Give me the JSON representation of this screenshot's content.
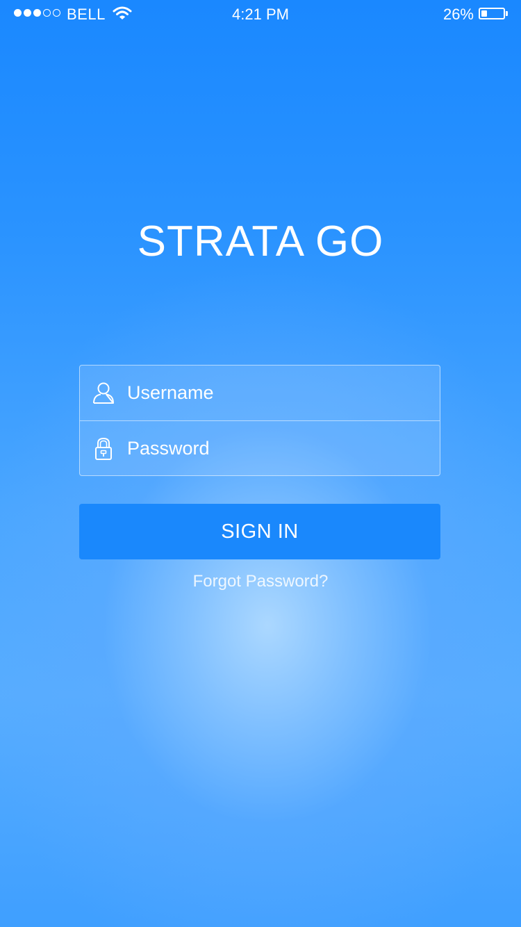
{
  "status_bar": {
    "signal_bars_filled": 3,
    "signal_bars_total": 5,
    "carrier": "BELL",
    "time": "4:21 PM",
    "battery_percent": "26%",
    "battery_level": 0.26
  },
  "app": {
    "title": "STRATA GO"
  },
  "login": {
    "username_placeholder": "Username",
    "password_placeholder": "Password",
    "sign_in_label": "SIGN IN",
    "forgot_password_label": "Forgot Password?"
  },
  "icons": {
    "username": "user-icon",
    "password": "lock-icon",
    "wifi": "wifi-icon",
    "battery": "battery-icon"
  },
  "colors": {
    "background_top": "#1a88ff",
    "background_glow": "#b0daff",
    "button": "#1a88fc",
    "text": "#ffffff"
  }
}
